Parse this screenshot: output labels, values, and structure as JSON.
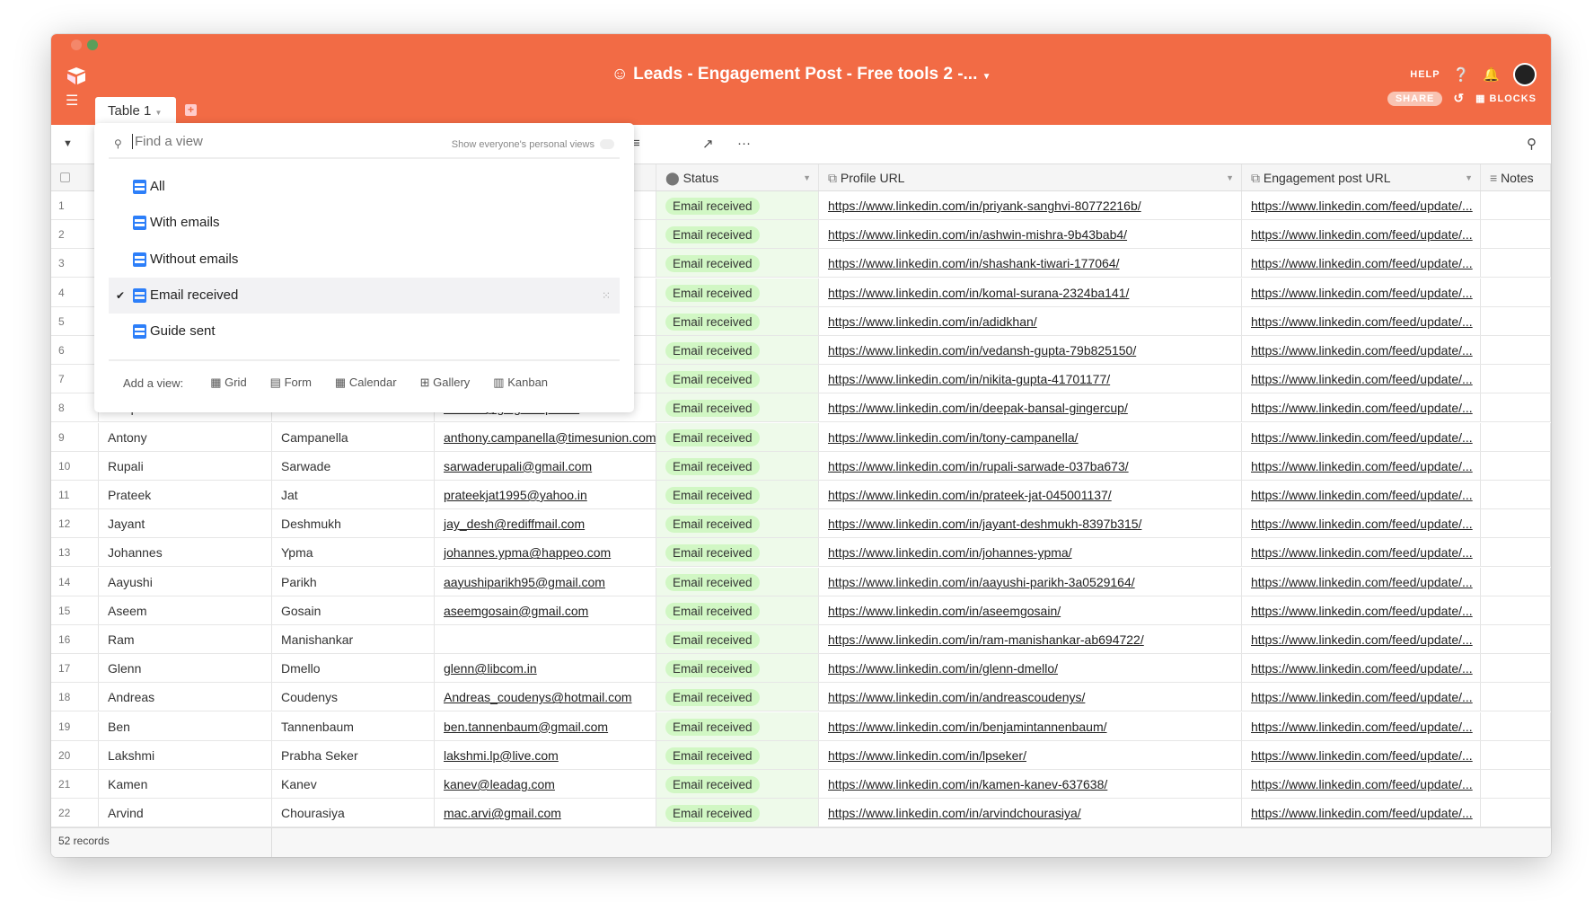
{
  "app": {
    "title": "Leads - Engagement Post - Free tools 2 -...",
    "help": "HELP",
    "share": "SHARE",
    "blocks": "BLOCKS",
    "tab": "Table 1",
    "accent": "#f26b45"
  },
  "views": {
    "search_placeholder": "Find a view",
    "personal_toggle": "Show everyone's personal views",
    "items": [
      "All",
      "With emails",
      "Without emails",
      "Email received",
      "Guide sent"
    ],
    "selected": "Email received",
    "add_label": "Add a view:",
    "add_types": [
      "Grid",
      "Form",
      "Calendar",
      "Gallery",
      "Kanban"
    ]
  },
  "columns": {
    "status": "Status",
    "profile": "Profile URL",
    "engagement": "Engagement post URL",
    "notes": "Notes"
  },
  "rows": [
    {
      "n": "1",
      "first": "",
      "last": "",
      "email": "",
      "status": "Email received",
      "profile": "https://www.linkedin.com/in/priyank-sanghvi-80772216b/",
      "eng": "https://www.linkedin.com/feed/update/..."
    },
    {
      "n": "2",
      "first": "",
      "last": "",
      "email": "",
      "status": "Email received",
      "profile": "https://www.linkedin.com/in/ashwin-mishra-9b43bab4/",
      "eng": "https://www.linkedin.com/feed/update/..."
    },
    {
      "n": "3",
      "first": "",
      "last": "",
      "email": "",
      "status": "Email received",
      "profile": "https://www.linkedin.com/in/shashank-tiwari-177064/",
      "eng": "https://www.linkedin.com/feed/update/..."
    },
    {
      "n": "4",
      "first": "",
      "last": "",
      "email": "",
      "status": "Email received",
      "profile": "https://www.linkedin.com/in/komal-surana-2324ba141/",
      "eng": "https://www.linkedin.com/feed/update/..."
    },
    {
      "n": "5",
      "first": "",
      "last": "",
      "email": "",
      "status": "Email received",
      "profile": "https://www.linkedin.com/in/adidkhan/",
      "eng": "https://www.linkedin.com/feed/update/..."
    },
    {
      "n": "6",
      "first": "",
      "last": "",
      "email": "",
      "status": "Email received",
      "profile": "https://www.linkedin.com/in/vedansh-gupta-79b825150/",
      "eng": "https://www.linkedin.com/feed/update/..."
    },
    {
      "n": "7",
      "first": "",
      "last": "",
      "email": "",
      "status": "Email received",
      "profile": "https://www.linkedin.com/in/nikita-gupta-41701177/",
      "eng": "https://www.linkedin.com/feed/update/..."
    },
    {
      "n": "8",
      "first": "Deepak",
      "last": "Bansal",
      "email": "contact@gingercup.com",
      "status": "Email received",
      "profile": "https://www.linkedin.com/in/deepak-bansal-gingercup/",
      "eng": "https://www.linkedin.com/feed/update/..."
    },
    {
      "n": "9",
      "first": "Antony",
      "last": "Campanella",
      "email": "anthony.campanella@timesunion.com",
      "status": "Email received",
      "profile": "https://www.linkedin.com/in/tony-campanella/",
      "eng": "https://www.linkedin.com/feed/update/..."
    },
    {
      "n": "10",
      "first": "Rupali",
      "last": "Sarwade",
      "email": "sarwaderupali@gmail.com",
      "status": "Email received",
      "profile": "https://www.linkedin.com/in/rupali-sarwade-037ba673/",
      "eng": "https://www.linkedin.com/feed/update/..."
    },
    {
      "n": "11",
      "first": "Prateek",
      "last": "Jat",
      "email": "prateekjat1995@yahoo.in",
      "status": "Email received",
      "profile": "https://www.linkedin.com/in/prateek-jat-045001137/",
      "eng": "https://www.linkedin.com/feed/update/..."
    },
    {
      "n": "12",
      "first": "Jayant",
      "last": "Deshmukh",
      "email": "jay_desh@rediffmail.com",
      "status": "Email received",
      "profile": "https://www.linkedin.com/in/jayant-deshmukh-8397b315/",
      "eng": "https://www.linkedin.com/feed/update/..."
    },
    {
      "n": "13",
      "first": "Johannes",
      "last": "Ypma",
      "email": "johannes.ypma@happeo.com",
      "status": "Email received",
      "profile": "https://www.linkedin.com/in/johannes-ypma/",
      "eng": "https://www.linkedin.com/feed/update/..."
    },
    {
      "n": "14",
      "first": "Aayushi",
      "last": "Parikh",
      "email": "aayushiparikh95@gmail.com",
      "status": "Email received",
      "profile": "https://www.linkedin.com/in/aayushi-parikh-3a0529164/",
      "eng": "https://www.linkedin.com/feed/update/..."
    },
    {
      "n": "15",
      "first": "Aseem",
      "last": "Gosain",
      "email": "aseemgosain@gmail.com",
      "status": "Email received",
      "profile": "https://www.linkedin.com/in/aseemgosain/",
      "eng": "https://www.linkedin.com/feed/update/..."
    },
    {
      "n": "16",
      "first": "Ram",
      "last": "Manishankar",
      "email": "",
      "status": "Email received",
      "profile": "https://www.linkedin.com/in/ram-manishankar-ab694722/",
      "eng": "https://www.linkedin.com/feed/update/..."
    },
    {
      "n": "17",
      "first": "Glenn",
      "last": "Dmello",
      "email": "glenn@libcom.in",
      "status": "Email received",
      "profile": "https://www.linkedin.com/in/glenn-dmello/",
      "eng": "https://www.linkedin.com/feed/update/..."
    },
    {
      "n": "18",
      "first": "Andreas",
      "last": "Coudenys",
      "email": "Andreas_coudenys@hotmail.com",
      "status": "Email received",
      "profile": "https://www.linkedin.com/in/andreascoudenys/",
      "eng": "https://www.linkedin.com/feed/update/..."
    },
    {
      "n": "19",
      "first": "Ben",
      "last": "Tannenbaum",
      "email": "ben.tannenbaum@gmail.com",
      "status": "Email received",
      "profile": "https://www.linkedin.com/in/benjamintannenbaum/",
      "eng": "https://www.linkedin.com/feed/update/..."
    },
    {
      "n": "20",
      "first": "Lakshmi",
      "last": "Prabha Seker",
      "email": "lakshmi.lp@live.com",
      "status": "Email received",
      "profile": "https://www.linkedin.com/in/lpseker/",
      "eng": "https://www.linkedin.com/feed/update/..."
    },
    {
      "n": "21",
      "first": "Kamen",
      "last": "Kanev",
      "email": "kanev@leadag.com",
      "status": "Email received",
      "profile": "https://www.linkedin.com/in/kamen-kanev-637638/",
      "eng": "https://www.linkedin.com/feed/update/..."
    },
    {
      "n": "22",
      "first": "Arvind",
      "last": "Chourasiya",
      "email": "mac.arvi@gmail.com",
      "status": "Email received",
      "profile": "https://www.linkedin.com/in/arvindchourasiya/",
      "eng": "https://www.linkedin.com/feed/update/..."
    }
  ],
  "footer": {
    "records": "52 records"
  }
}
